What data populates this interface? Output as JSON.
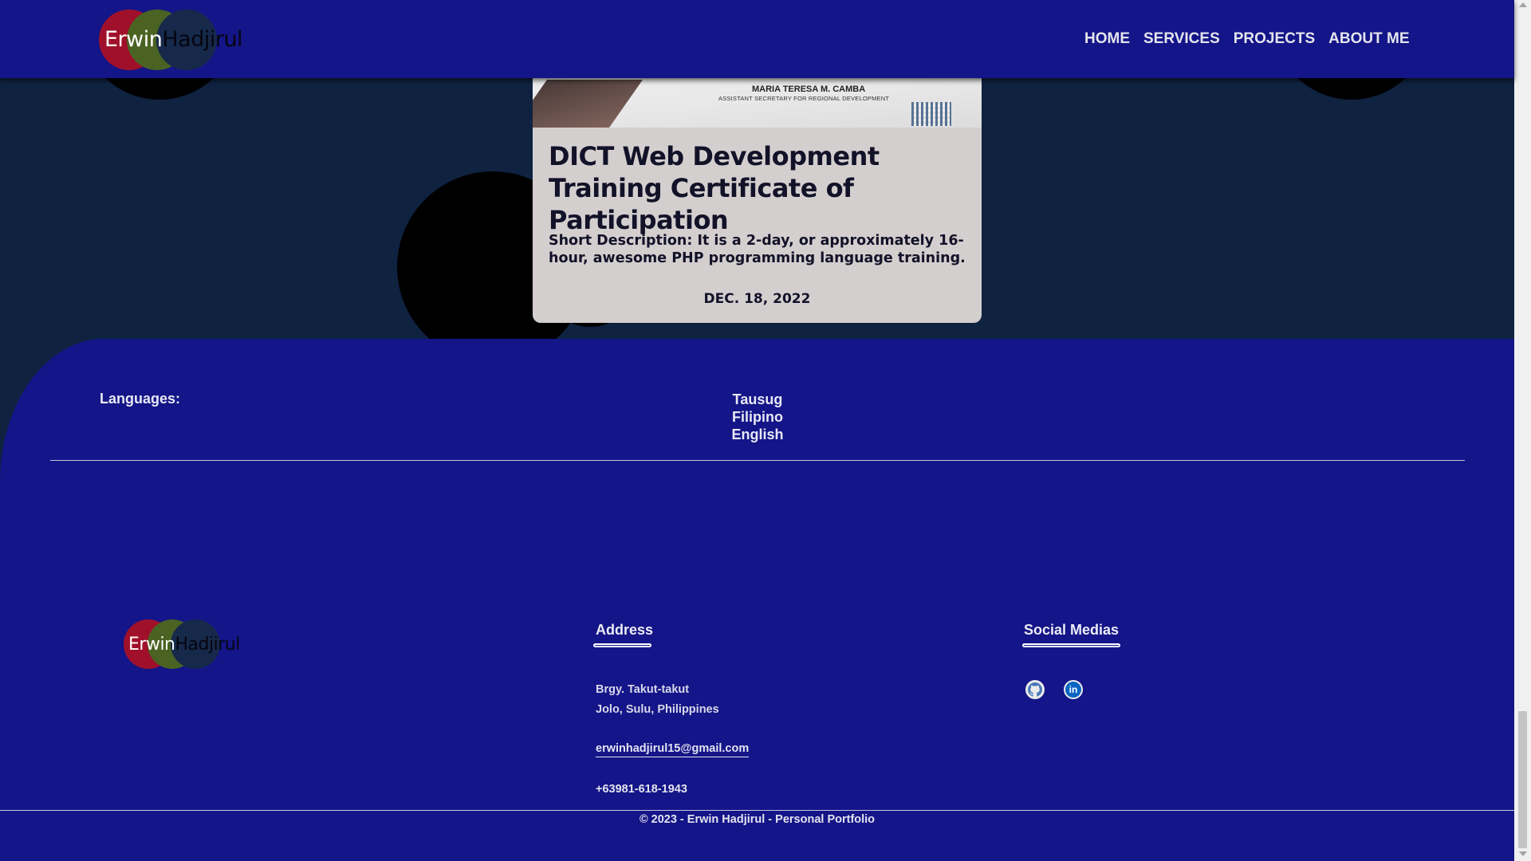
{
  "header": {
    "logo": {
      "first": "Erwin",
      "last": "Hadjirul"
    },
    "nav": [
      {
        "label": "HOME"
      },
      {
        "label": "SERVICES"
      },
      {
        "label": "PROJECTS"
      },
      {
        "label": "ABOUT ME"
      }
    ]
  },
  "card": {
    "image": {
      "signatory_name": "MARIA TERESA M. CAMBA",
      "signatory_role": "ASSISTANT SECRETARY FOR REGIONAL DEVELOPMENT"
    },
    "title": "DICT Web Development Training Certificate of Participation",
    "description": "Short Description: It is a 2-day, or approximately 16-hour, awesome PHP programming language training.",
    "date": "DEC. 18, 2022"
  },
  "languages": {
    "label": "Languages:",
    "items": [
      "Tausug",
      "Filipino",
      "English"
    ]
  },
  "footer": {
    "logo": {
      "first": "Erwin",
      "last": "Hadjirul"
    },
    "address": {
      "heading": "Address",
      "line1": "Brgy. Takut-takut",
      "line2": "Jolo, Sulu, Philippines",
      "email": "erwinhadjirul15@gmail.com",
      "phone": "+63981-618-1943"
    },
    "social": {
      "heading": "Social Medias",
      "icons": [
        "github-icon",
        "linkedin-icon"
      ]
    },
    "copyright": "© 2023 - Erwin Hadjirul - Personal Portfolio"
  },
  "colors": {
    "header_bg": "#141588",
    "section_bg": "#0f2240",
    "card_bg": "#d4cfcf",
    "logo_red": "#a0102a",
    "logo_green": "#4a6322",
    "logo_navy": "#16294a"
  }
}
